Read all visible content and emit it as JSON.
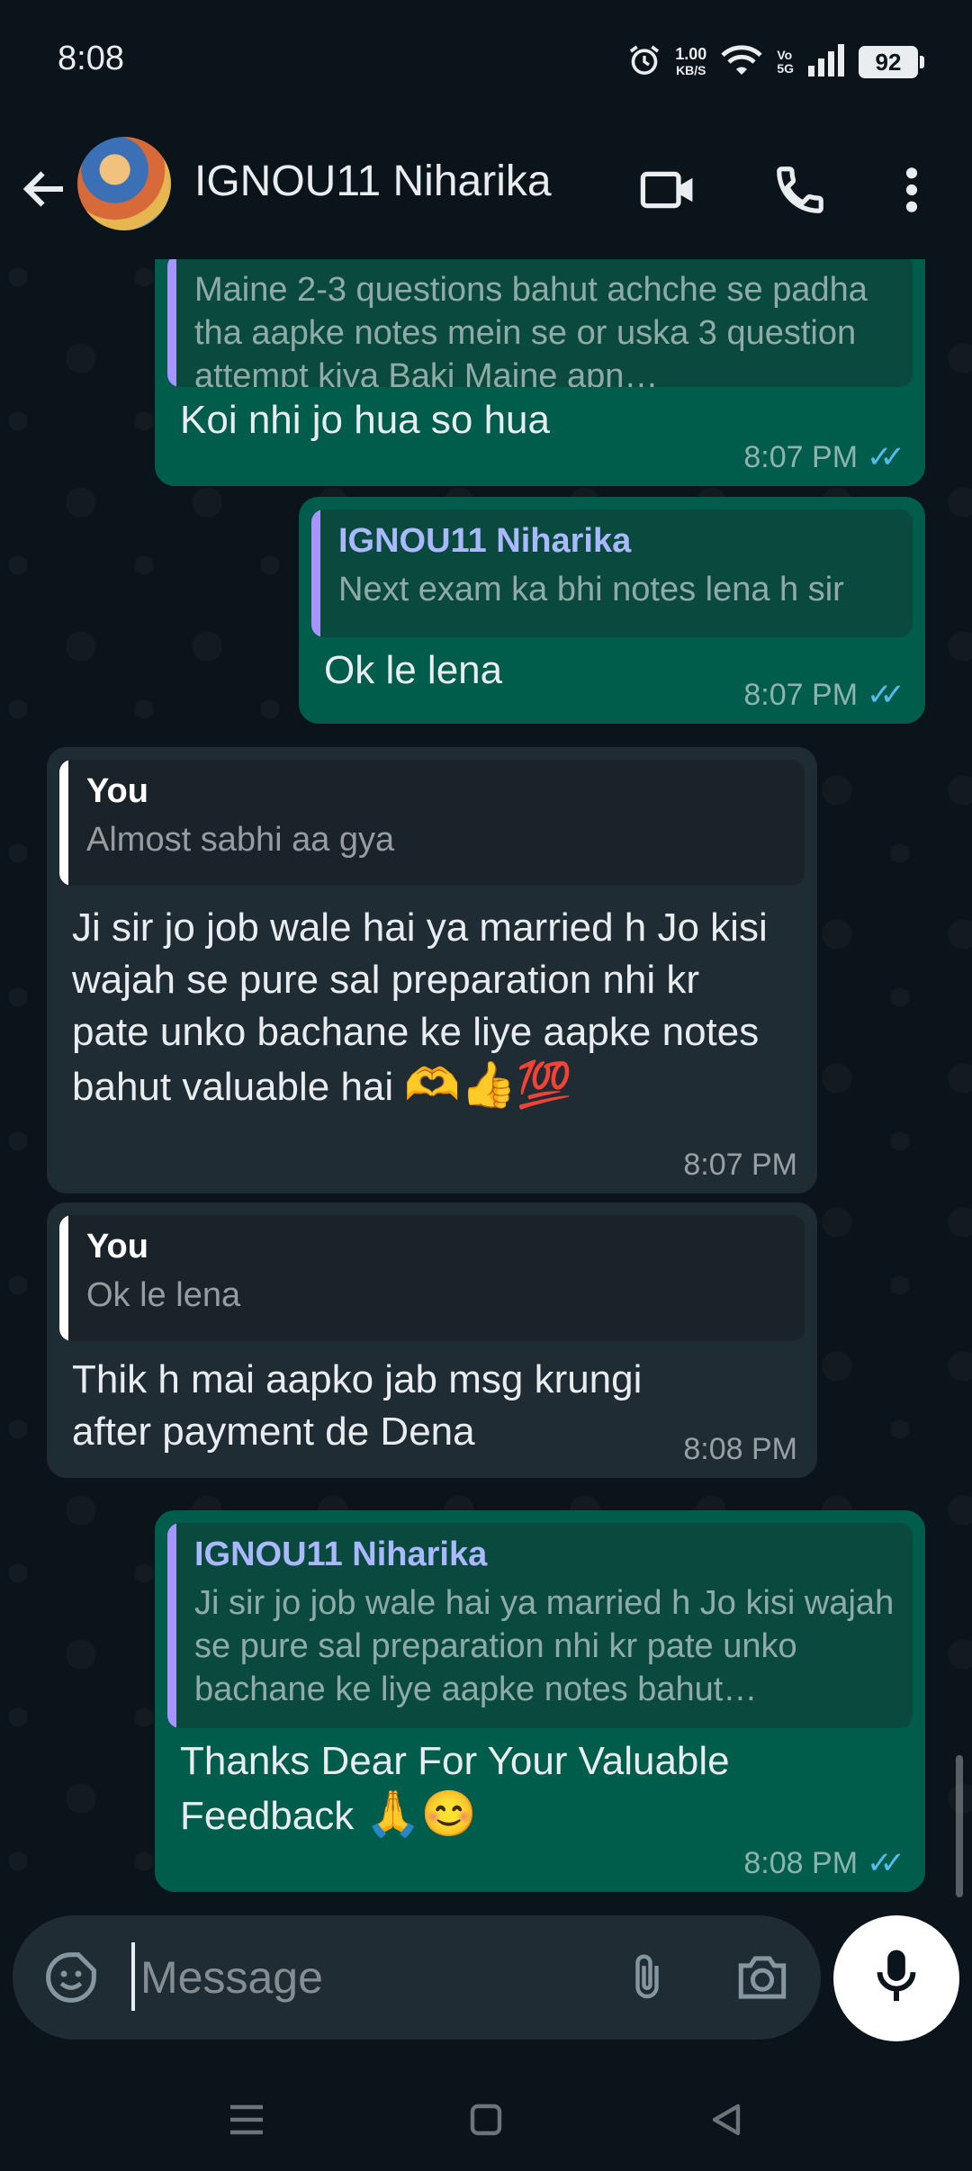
{
  "status_bar": {
    "time": "8:08",
    "net_speed_value": "1.00",
    "net_speed_unit": "KB/S",
    "volte_top": "Vo",
    "volte_bottom": "5G",
    "battery": "92"
  },
  "header": {
    "contact_name": "IGNOU11 Niharika",
    "icons": [
      "back-arrow-icon",
      "video-call-icon",
      "phone-icon",
      "more-vert-icon"
    ]
  },
  "messages": [
    {
      "direction": "out",
      "quote_text": "Maine 2-3 questions bahut achche se padha tha aapke notes mein se or uska 3 question attempt kiya Baki Maine apn…",
      "text": "Koi nhi jo hua so hua",
      "time": "8:07 PM",
      "read": true
    },
    {
      "direction": "out",
      "quote_author": "IGNOU11 Niharika",
      "quote_text": "Next exam ka bhi notes lena h sir",
      "text": "Ok le lena",
      "time": "8:07 PM",
      "read": true
    },
    {
      "direction": "in",
      "quote_author": "You",
      "quote_text": "Almost sabhi aa gya",
      "text": "Ji sir jo job wale hai ya married h Jo kisi wajah se pure sal preparation nhi kr pate unko bachane ke liye aapke notes bahut valuable hai",
      "emojis": "🫶👍💯",
      "time": "8:07 PM"
    },
    {
      "direction": "in",
      "quote_author": "You",
      "quote_text": "Ok le lena",
      "text": "Thik h mai aapko jab msg krungi after payment de Dena",
      "time": "8:08 PM"
    },
    {
      "direction": "out",
      "quote_author": "IGNOU11 Niharika",
      "quote_text": "Ji sir jo job wale hai ya married h Jo kisi wajah se pure sal preparation nhi kr pate unko bachane ke liye aapke notes bahut…",
      "text": "Thanks Dear For Your Valuable Feedback",
      "emojis": "🙏😊",
      "time": "8:08 PM",
      "read": true
    }
  ],
  "composer": {
    "placeholder": "Message",
    "icons": [
      "sticker-icon",
      "attach-icon",
      "camera-icon",
      "mic-icon"
    ]
  },
  "navbar": {
    "icons": [
      "menu-nav-icon",
      "home-nav-icon",
      "back-nav-icon"
    ]
  },
  "colors": {
    "background": "#0b141a",
    "outgoing_bubble": "#005c4b",
    "incoming_bubble": "#1f2c34",
    "read_ticks": "#53bdeb",
    "quote_bar_out": "#a695ff"
  }
}
